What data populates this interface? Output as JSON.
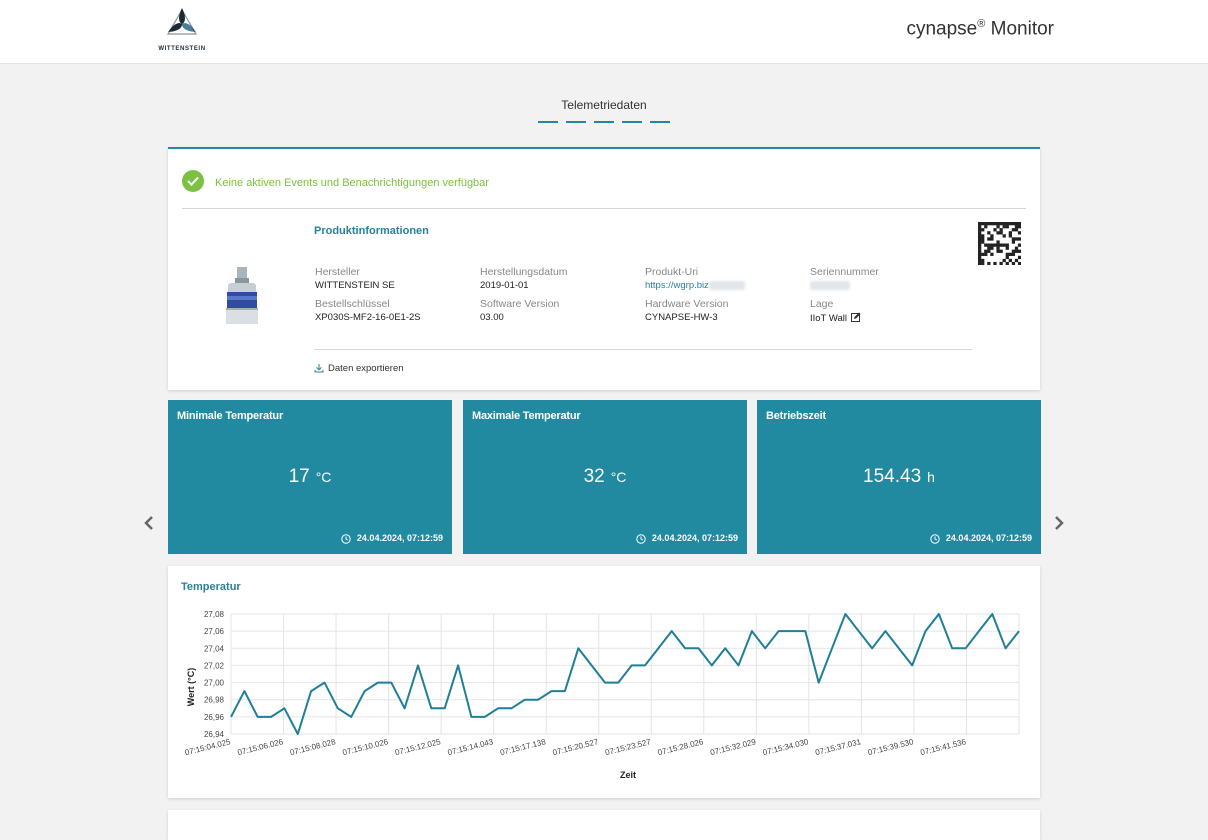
{
  "header": {
    "logo_text": "WITTENSTEIN",
    "app_title_brand": "cynapse",
    "app_title_reg": "®",
    "app_title_rest": " Monitor"
  },
  "page": {
    "title": "Telemetriedaten",
    "step_count": 5
  },
  "alert": {
    "text": "Keine aktiven Events und Benachrichtigungen verfügbar",
    "color": "#7bc143"
  },
  "product_info": {
    "title": "Produktinformationen",
    "fields": [
      {
        "label": "Hersteller",
        "value": "WITTENSTEIN SE"
      },
      {
        "label": "Herstellungsdatum",
        "value": "2019-01-01"
      },
      {
        "label": "Produkt-Uri",
        "value": "https://wgrp.biz"
      },
      {
        "label": "Seriennummer",
        "value": ""
      },
      {
        "label": "Bestellschlüssel",
        "value": "XP030S-MF2-16-0E1-2S"
      },
      {
        "label": "Software Version",
        "value": "03.00"
      },
      {
        "label": "Hardware Version",
        "value": "CYNAPSE-HW-3"
      },
      {
        "label": "Lage",
        "value": "IIoT Wall"
      }
    ],
    "export_label": "Daten exportieren"
  },
  "kpis": [
    {
      "title": "Minimale Temperatur",
      "value": "17",
      "unit": "°C",
      "timestamp": "24.04.2024, 07:12:59"
    },
    {
      "title": "Maximale Temperatur",
      "value": "32",
      "unit": "°C",
      "timestamp": "24.04.2024, 07:12:59"
    },
    {
      "title": "Betriebszeit",
      "value": "154.43",
      "unit": "h",
      "timestamp": "24.04.2024, 07:12:59"
    }
  ],
  "colors": {
    "accent": "#2189a0",
    "success": "#7bc143",
    "link": "#2b7f9b"
  },
  "chart_data": {
    "type": "line",
    "title": "Temperatur",
    "xlabel": "Zeit",
    "ylabel": "Wert (°C)",
    "ylim": [
      26.94,
      27.08
    ],
    "yticks": [
      "27,08",
      "27,06",
      "27,04",
      "27,02",
      "27,00",
      "26,98",
      "26,96",
      "26,94"
    ],
    "xticks": [
      "07:15:04.025",
      "07:15:06.026",
      "07:15:08.028",
      "07:15:10.026",
      "07:15:12.025",
      "07:15:14.043",
      "07:15:17.138",
      "07:15:20.527",
      "07:15:23.527",
      "07:15:28.026",
      "07:15:32.029",
      "07:15:34.030",
      "07:15:37.031",
      "07:15:39.530",
      "07:15:41.536"
    ],
    "grid": true,
    "series": [
      {
        "values": [
          26.96,
          26.99,
          26.96,
          26.96,
          26.97,
          26.94,
          26.99,
          27.0,
          26.97,
          26.96,
          26.99,
          27.0,
          27.0,
          26.97,
          27.02,
          26.97,
          26.97,
          27.02,
          26.96,
          26.96,
          26.97,
          26.97,
          26.98,
          26.98,
          26.99,
          26.99,
          27.04,
          27.02,
          27.0,
          27.0,
          27.02,
          27.02,
          27.04,
          27.06,
          27.04,
          27.04,
          27.02,
          27.04,
          27.02,
          27.06,
          27.04,
          27.06,
          27.06,
          27.06,
          27.0,
          27.04,
          27.08,
          27.06,
          27.04,
          27.06,
          27.04,
          27.02,
          27.06,
          27.08,
          27.04,
          27.04,
          27.06,
          27.08,
          27.04,
          27.06
        ]
      }
    ]
  }
}
